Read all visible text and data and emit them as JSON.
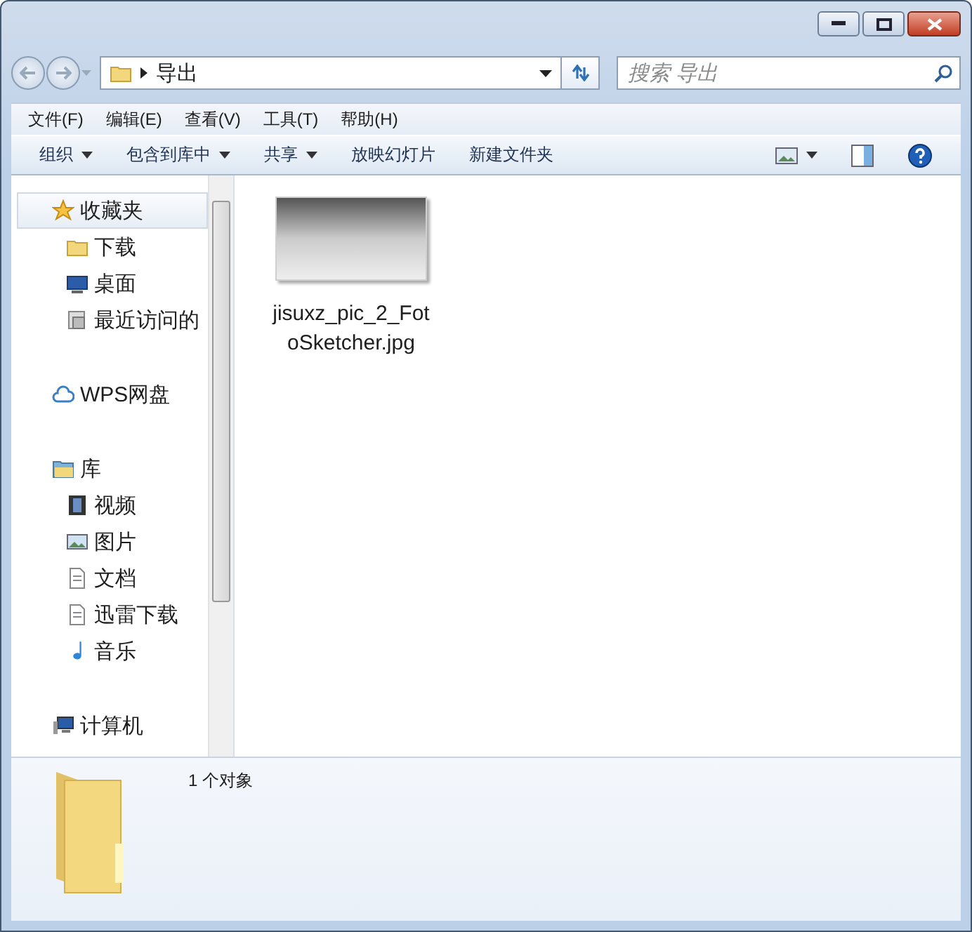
{
  "address": {
    "path": [
      "导出"
    ]
  },
  "search": {
    "placeholder": "搜索 导出"
  },
  "menu": [
    "文件(F)",
    "编辑(E)",
    "查看(V)",
    "工具(T)",
    "帮助(H)"
  ],
  "toolbar": [
    {
      "label": "组织",
      "dropdown": true
    },
    {
      "label": "包含到库中",
      "dropdown": true
    },
    {
      "label": "共享",
      "dropdown": true
    },
    {
      "label": "放映幻灯片",
      "dropdown": false
    },
    {
      "label": "新建文件夹",
      "dropdown": false
    }
  ],
  "nav": [
    {
      "label": "收藏夹",
      "kind": "star",
      "selected": true,
      "children": [
        {
          "label": "下载",
          "kind": "folder",
          "selected": false
        },
        {
          "label": "桌面",
          "kind": "desktop",
          "selected": false
        },
        {
          "label": "最近访问的",
          "kind": "recent",
          "selected": false
        }
      ]
    },
    {
      "label": "WPS网盘",
      "kind": "cloud",
      "selected": false
    },
    {
      "label": "库",
      "kind": "library",
      "selected": false,
      "children": [
        {
          "label": "视频",
          "kind": "video",
          "selected": false
        },
        {
          "label": "图片",
          "kind": "picture",
          "selected": false
        },
        {
          "label": "文档",
          "kind": "document",
          "selected": false
        },
        {
          "label": "迅雷下载",
          "kind": "document",
          "selected": false
        },
        {
          "label": "音乐",
          "kind": "music",
          "selected": false
        }
      ]
    },
    {
      "label": "计算机",
      "kind": "computer",
      "selected": false
    }
  ],
  "files": [
    {
      "name": "jisuxz_pic_2_FotoSketcher.jpg",
      "selected": false
    }
  ],
  "details": {
    "count": "1 个对象"
  }
}
